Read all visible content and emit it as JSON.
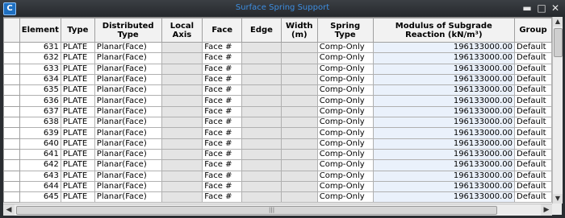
{
  "window": {
    "title": "Surface Spring Support",
    "app_icon": "C",
    "buttons": {
      "minimize": "▬",
      "maximize": "□",
      "close": "✕"
    }
  },
  "table": {
    "columns": [
      "Element",
      "Type",
      "Distributed Type",
      "Local Axis",
      "Face",
      "Edge",
      "Width (m)",
      "Spring Type",
      "Modulus of Subgrade Reaction (kN/m³)",
      "Group"
    ],
    "rows": [
      {
        "element": "631",
        "type": "PLATE",
        "distributed_type": "Planar(Face)",
        "local_axis": "",
        "face": "Face #",
        "edge": "",
        "width": "",
        "spring_type": "Comp-Only",
        "modulus": "196133000.00",
        "group": "Default"
      },
      {
        "element": "632",
        "type": "PLATE",
        "distributed_type": "Planar(Face)",
        "local_axis": "",
        "face": "Face #",
        "edge": "",
        "width": "",
        "spring_type": "Comp-Only",
        "modulus": "196133000.00",
        "group": "Default"
      },
      {
        "element": "633",
        "type": "PLATE",
        "distributed_type": "Planar(Face)",
        "local_axis": "",
        "face": "Face #",
        "edge": "",
        "width": "",
        "spring_type": "Comp-Only",
        "modulus": "196133000.00",
        "group": "Default"
      },
      {
        "element": "634",
        "type": "PLATE",
        "distributed_type": "Planar(Face)",
        "local_axis": "",
        "face": "Face #",
        "edge": "",
        "width": "",
        "spring_type": "Comp-Only",
        "modulus": "196133000.00",
        "group": "Default"
      },
      {
        "element": "635",
        "type": "PLATE",
        "distributed_type": "Planar(Face)",
        "local_axis": "",
        "face": "Face #",
        "edge": "",
        "width": "",
        "spring_type": "Comp-Only",
        "modulus": "196133000.00",
        "group": "Default"
      },
      {
        "element": "636",
        "type": "PLATE",
        "distributed_type": "Planar(Face)",
        "local_axis": "",
        "face": "Face #",
        "edge": "",
        "width": "",
        "spring_type": "Comp-Only",
        "modulus": "196133000.00",
        "group": "Default"
      },
      {
        "element": "637",
        "type": "PLATE",
        "distributed_type": "Planar(Face)",
        "local_axis": "",
        "face": "Face #",
        "edge": "",
        "width": "",
        "spring_type": "Comp-Only",
        "modulus": "196133000.00",
        "group": "Default"
      },
      {
        "element": "638",
        "type": "PLATE",
        "distributed_type": "Planar(Face)",
        "local_axis": "",
        "face": "Face #",
        "edge": "",
        "width": "",
        "spring_type": "Comp-Only",
        "modulus": "196133000.00",
        "group": "Default"
      },
      {
        "element": "639",
        "type": "PLATE",
        "distributed_type": "Planar(Face)",
        "local_axis": "",
        "face": "Face #",
        "edge": "",
        "width": "",
        "spring_type": "Comp-Only",
        "modulus": "196133000.00",
        "group": "Default"
      },
      {
        "element": "640",
        "type": "PLATE",
        "distributed_type": "Planar(Face)",
        "local_axis": "",
        "face": "Face #",
        "edge": "",
        "width": "",
        "spring_type": "Comp-Only",
        "modulus": "196133000.00",
        "group": "Default"
      },
      {
        "element": "641",
        "type": "PLATE",
        "distributed_type": "Planar(Face)",
        "local_axis": "",
        "face": "Face #",
        "edge": "",
        "width": "",
        "spring_type": "Comp-Only",
        "modulus": "196133000.00",
        "group": "Default"
      },
      {
        "element": "642",
        "type": "PLATE",
        "distributed_type": "Planar(Face)",
        "local_axis": "",
        "face": "Face #",
        "edge": "",
        "width": "",
        "spring_type": "Comp-Only",
        "modulus": "196133000.00",
        "group": "Default"
      },
      {
        "element": "643",
        "type": "PLATE",
        "distributed_type": "Planar(Face)",
        "local_axis": "",
        "face": "Face #",
        "edge": "",
        "width": "",
        "spring_type": "Comp-Only",
        "modulus": "196133000.00",
        "group": "Default"
      },
      {
        "element": "644",
        "type": "PLATE",
        "distributed_type": "Planar(Face)",
        "local_axis": "",
        "face": "Face #",
        "edge": "",
        "width": "",
        "spring_type": "Comp-Only",
        "modulus": "196133000.00",
        "group": "Default"
      },
      {
        "element": "645",
        "type": "PLATE",
        "distributed_type": "Planar(Face)",
        "local_axis": "",
        "face": "Face #",
        "edge": "",
        "width": "",
        "spring_type": "Comp-Only",
        "modulus": "196133000.00",
        "group": "Default"
      }
    ]
  },
  "scrollbars": {
    "vertical": {
      "up": "▲",
      "down": "▼"
    },
    "horizontal": {
      "left": "◀",
      "right": "▶",
      "grip": "|||"
    }
  },
  "colors": {
    "titlebar": "#2a2d31",
    "title_text": "#3e8ee0",
    "empty_cell": "#e4e4e4",
    "modulus_cell": "#eaf1fb"
  }
}
